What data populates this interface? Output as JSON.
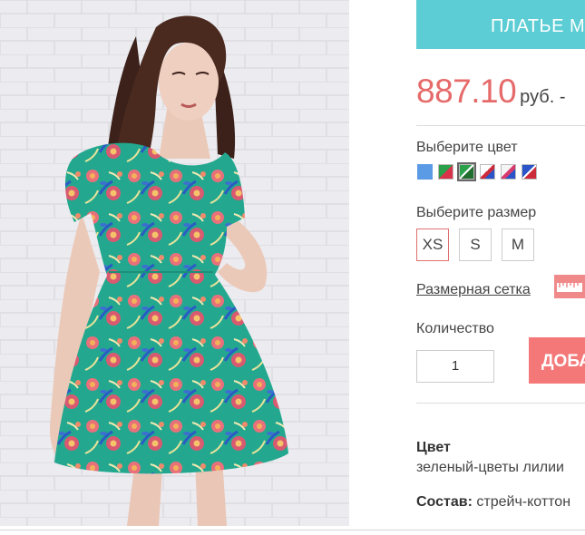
{
  "product": {
    "title": "ПЛАТЬЕ М",
    "price": "887.10",
    "currency": "руб. -"
  },
  "color_picker": {
    "label": "Выберите цвет",
    "swatches": [
      {
        "name": "blue",
        "colors": [
          "#5b9be6"
        ]
      },
      {
        "name": "green-flowers",
        "colors": [
          "#2aa04a",
          "#d9324b"
        ]
      },
      {
        "name": "green-lily-selected",
        "colors": [
          "#2aa04a",
          "#1f6e2e"
        ]
      },
      {
        "name": "white-red-blue",
        "colors": [
          "#ffffff",
          "#cc2b3b",
          "#2a54c8"
        ]
      },
      {
        "name": "white-pink-blue",
        "colors": [
          "#f4f4f4",
          "#d83a6e",
          "#2a54c8"
        ]
      },
      {
        "name": "blue-red",
        "colors": [
          "#2a54c8",
          "#ffffff",
          "#cc2b3b"
        ]
      }
    ]
  },
  "size_picker": {
    "label": "Выберите размер",
    "sizes": [
      "XS",
      "S",
      "M"
    ],
    "selected": "XS"
  },
  "size_chart": {
    "link_text": "Размерная сетка",
    "icon": "ruler-icon"
  },
  "quantity": {
    "label": "Количество",
    "value": "1"
  },
  "cart": {
    "button_label": "ДОБА"
  },
  "specs": {
    "color_title": "Цвет",
    "color_value": "зеленый-цветы лилии",
    "composition_title": "Состав:",
    "composition_value": "стрейч-коттон"
  },
  "colors": {
    "accent": "#5ccdd4",
    "price": "#e66a6a",
    "cart_button": "#f47878",
    "selected_size_border": "#e17070"
  }
}
